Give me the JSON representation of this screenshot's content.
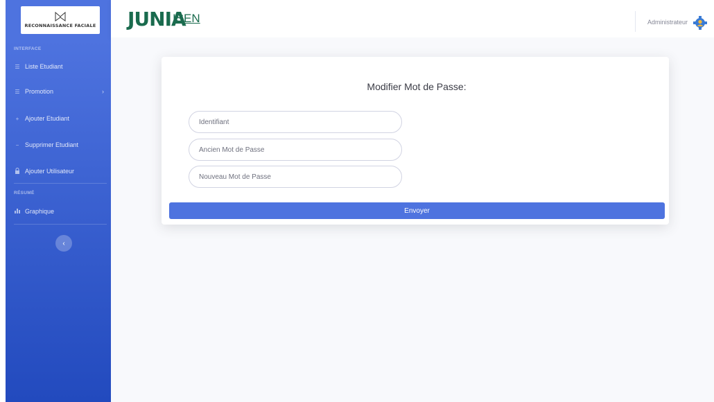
{
  "sidebar": {
    "brand_text": "RECONNAISSANCE FACIALE",
    "heading_interface": "INTERFACE",
    "heading_resume": "RÉSUMÉ",
    "items": [
      {
        "label": "Liste Etudiant",
        "icon": "table-icon"
      },
      {
        "label": "Promotion",
        "icon": "table-icon",
        "has_chevron": true
      },
      {
        "label": "Ajouter Etudiant",
        "icon": "plus-icon"
      },
      {
        "label": "Supprimer Etudiant",
        "icon": "minus-icon"
      },
      {
        "label": "Ajouter Utilisateur",
        "icon": "lock-icon"
      },
      {
        "label": "Graphique",
        "icon": "bar-chart-icon"
      }
    ],
    "chevron_symbol": "›",
    "toggle_symbol": "‹"
  },
  "topbar": {
    "logo_main": "JUNIA",
    "logo_sub": "ISEN",
    "user_name": "Administrateur"
  },
  "form": {
    "title": "Modifier Mot de Passe:",
    "fields": [
      {
        "placeholder": "Identifiant"
      },
      {
        "placeholder": "Ancien Mot de Passe"
      },
      {
        "placeholder": "Nouveau Mot de Passe"
      }
    ],
    "submit_label": "Envoyer"
  },
  "colors": {
    "primary": "#4e73df",
    "sidebar_dark": "#224abe",
    "brand_green": "#1a6b4e",
    "background": "#f8f9fc"
  }
}
